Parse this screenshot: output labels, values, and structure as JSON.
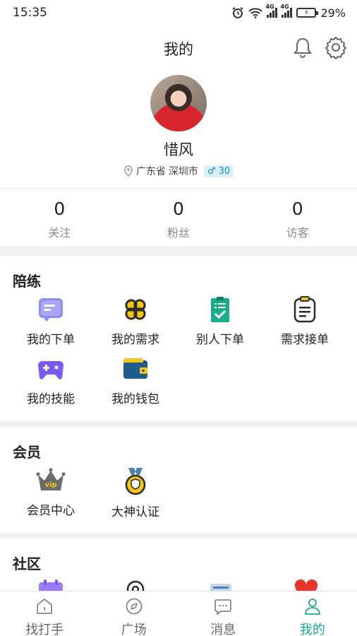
{
  "status_bar": {
    "time": "15:35",
    "battery": "29%"
  },
  "header": {
    "title": "我的"
  },
  "profile": {
    "name": "惜风",
    "province": "广东省",
    "city": "深圳市",
    "gender_symbol": "♂",
    "age": "30"
  },
  "stats": [
    {
      "value": "0",
      "label": "关注"
    },
    {
      "value": "0",
      "label": "粉丝"
    },
    {
      "value": "0",
      "label": "访客"
    }
  ],
  "sections": {
    "peilian": {
      "title": "陪练",
      "items": [
        {
          "label": "我的下单",
          "icon": "chat-list-icon"
        },
        {
          "label": "我的需求",
          "icon": "clover-icon"
        },
        {
          "label": "别人下单",
          "icon": "clipboard-check-icon"
        },
        {
          "label": "需求接单",
          "icon": "notepad-icon"
        },
        {
          "label": "我的技能",
          "icon": "gamepad-icon"
        },
        {
          "label": "我的钱包",
          "icon": "wallet-icon"
        }
      ]
    },
    "member": {
      "title": "会员",
      "items": [
        {
          "label": "会员中心",
          "icon": "vip-crown-icon"
        },
        {
          "label": "大神认证",
          "icon": "medal-icon"
        }
      ]
    },
    "community": {
      "title": "社区"
    }
  },
  "tabbar": [
    {
      "label": "找打手",
      "icon": "home-icon"
    },
    {
      "label": "广场",
      "icon": "compass-icon"
    },
    {
      "label": "消息",
      "icon": "message-icon"
    },
    {
      "label": "我的",
      "icon": "person-icon",
      "active": true
    }
  ],
  "colors": {
    "accent": "#1aab8a",
    "background": "#f2f2f2"
  }
}
